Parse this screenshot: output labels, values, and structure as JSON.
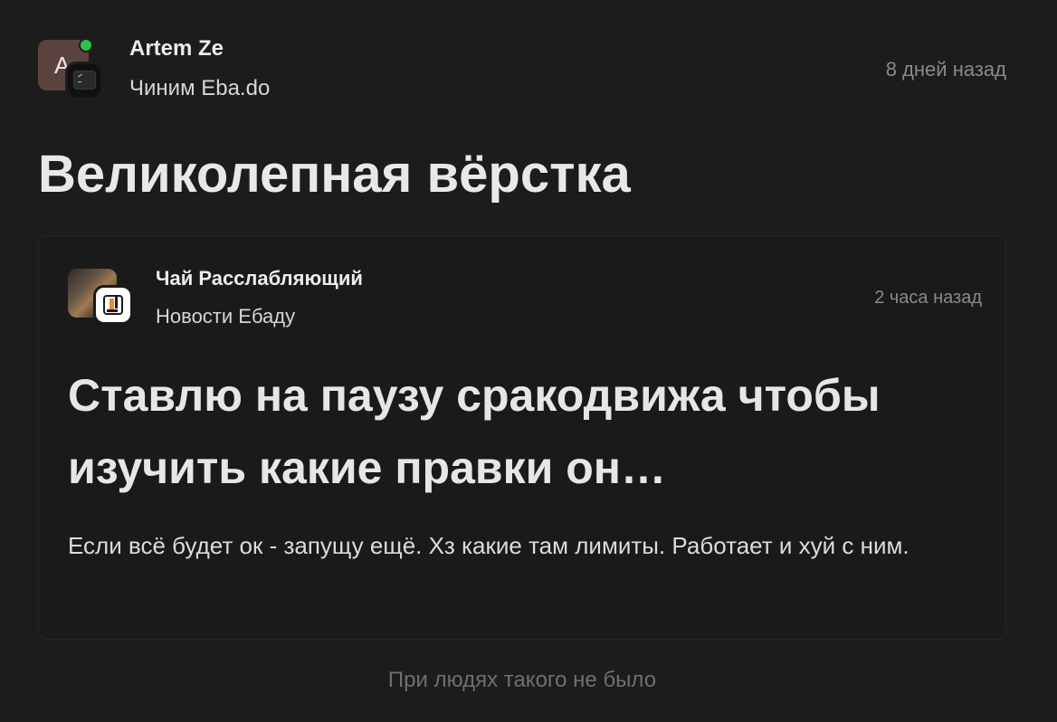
{
  "post": {
    "author": "Artem Ze",
    "author_initial": "A",
    "community": "Чиним Eba.do",
    "timestamp": "8 дней назад",
    "title": "Великолепная вёрстка"
  },
  "embed": {
    "author": "Чай Расслабляющий",
    "community": "Новости Ебаду",
    "timestamp": "2 часа назад",
    "title": "Ставлю на паузу сракодвижа чтобы изучить какие правки он…",
    "body": "Если всё будет ок - запущу ещё. Хз какие там лимиты. Работает и хуй с ним."
  },
  "footer": {
    "note": "При людях такого не было"
  },
  "icons": {
    "post_community_badge": "terminal-icon",
    "embed_community_badge": "ebado-logo-icon",
    "online_status": "online-dot-icon"
  },
  "colors": {
    "background": "#1c1c1c",
    "online": "#2fbf4a",
    "logo_orange": "#f08a24"
  }
}
